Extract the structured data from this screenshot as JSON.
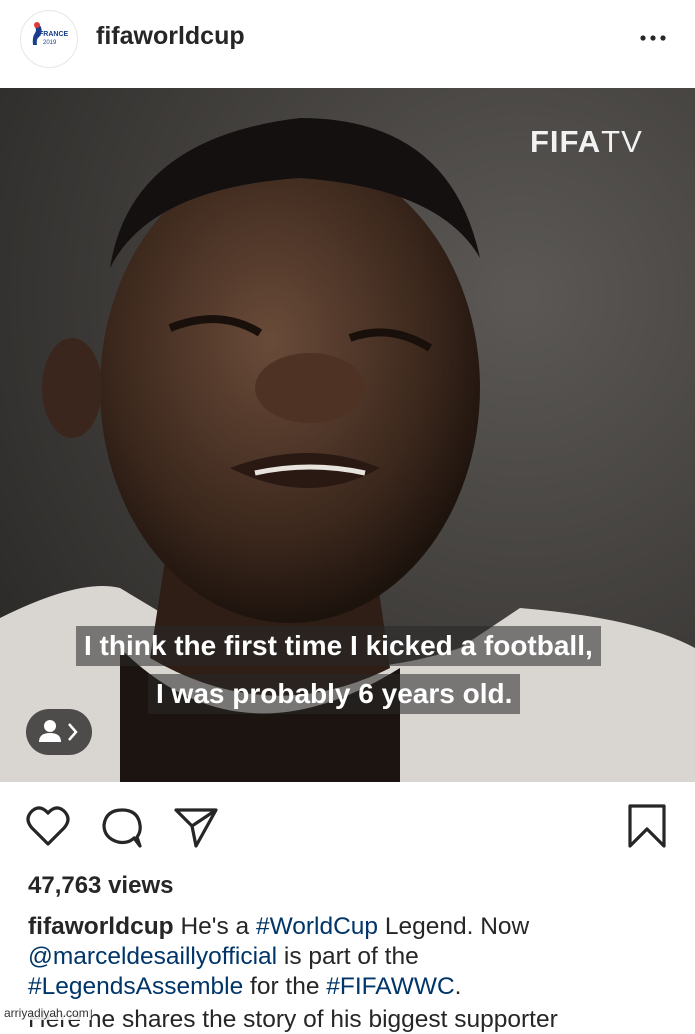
{
  "post": {
    "username": "fifaworldcup",
    "avatar_text_top": "FRANCE",
    "avatar_text_bottom": "2019",
    "more_icon": "ellipsis-icon"
  },
  "media": {
    "watermark_brand_bold": "FIFA",
    "watermark_brand_light": "TV",
    "subtitle_line1": "I think the first time I kicked a football,",
    "subtitle_line2": "I was probably 6 years old.",
    "tag_icon": "person-tag-icon"
  },
  "actions": {
    "like_icon": "heart-icon",
    "comment_icon": "comment-icon",
    "share_icon": "send-icon",
    "save_icon": "bookmark-icon"
  },
  "stats": {
    "views": "47,763 views"
  },
  "caption": {
    "username": "fifaworldcup",
    "t1": " He's a ",
    "tag_worldcup": "#WorldCup",
    "t2": " Legend. Now",
    "mention": "@marceldesaillyofficial",
    "t3": " is part of the",
    "tag_legends": "#LegendsAssemble",
    "t4": " for the ",
    "tag_fifawwc": "#FIFAWWC",
    "t5": ".",
    "cut_line": "Here he shares the story of his biggest supporter"
  },
  "site_watermark": "arriyadiyah.com",
  "colors": {
    "text": "#262626",
    "link": "#003569",
    "background": "#ffffff"
  }
}
